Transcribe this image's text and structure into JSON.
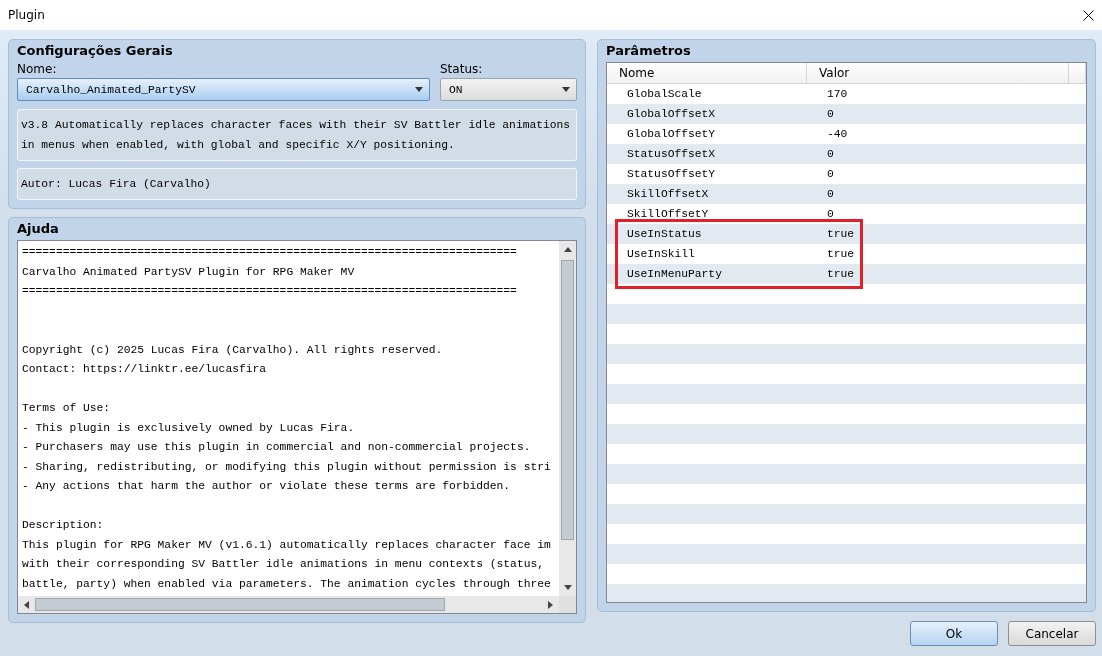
{
  "window": {
    "title": "Plugin"
  },
  "general": {
    "title": "Configurações Gerais",
    "name_label": "Nome:",
    "name_value": "Carvalho_Animated_PartySV",
    "status_label": "Status:",
    "status_value": "ON",
    "description": [
      "v3.8 Automatically replaces character faces with their SV Battler idle animations",
      "in menus when enabled, with global and specific X/Y positioning."
    ],
    "author": "Autor: Lucas Fira (Carvalho)"
  },
  "help": {
    "title": "Ajuda",
    "blocks": [
      [
        "=========================================================================",
        "Carvalho Animated PartySV Plugin for RPG Maker MV",
        "========================================================================="
      ],
      [
        "Copyright (c) 2025 Lucas Fira (Carvalho). All rights reserved.",
        "Contact: https://linktr.ee/lucasfira"
      ],
      [
        "Terms of Use:",
        "- This plugin is exclusively owned by Lucas Fira.",
        "- Purchasers may use this plugin in commercial and non-commercial projects.",
        "- Sharing, redistributing, or modifying this plugin without permission is stri",
        "- Any actions that harm the author or violate these terms are forbidden."
      ],
      [
        "Description:",
        "This plugin for RPG Maker MV (v1.6.1) automatically replaces character face im",
        "with their corresponding SV Battler idle animations in menu contexts (status,",
        "battle, party) when enabled via parameters. The animation cycles through three"
      ]
    ]
  },
  "parameters": {
    "title": "Parâmetros",
    "columns": [
      "Nome",
      "Valor"
    ],
    "rows": [
      {
        "name": "GlobalScale",
        "value": "170",
        "highlighted": false
      },
      {
        "name": "GlobalOffsetX",
        "value": "0",
        "highlighted": false
      },
      {
        "name": "GlobalOffsetY",
        "value": "-40",
        "highlighted": false
      },
      {
        "name": "StatusOffsetX",
        "value": "0",
        "highlighted": false
      },
      {
        "name": "StatusOffsetY",
        "value": "0",
        "highlighted": false
      },
      {
        "name": "SkillOffsetX",
        "value": "0",
        "highlighted": false
      },
      {
        "name": "SkillOffsetY",
        "value": "0",
        "highlighted": false
      },
      {
        "name": "UseInStatus",
        "value": "true",
        "highlighted": true
      },
      {
        "name": "UseInSkill",
        "value": "true",
        "highlighted": true
      },
      {
        "name": "UseInMenuParty",
        "value": "true",
        "highlighted": true
      }
    ]
  },
  "buttons": [
    {
      "label": "Ok",
      "kind": "primary"
    },
    {
      "label": "Cancelar",
      "kind": "secondary"
    }
  ]
}
